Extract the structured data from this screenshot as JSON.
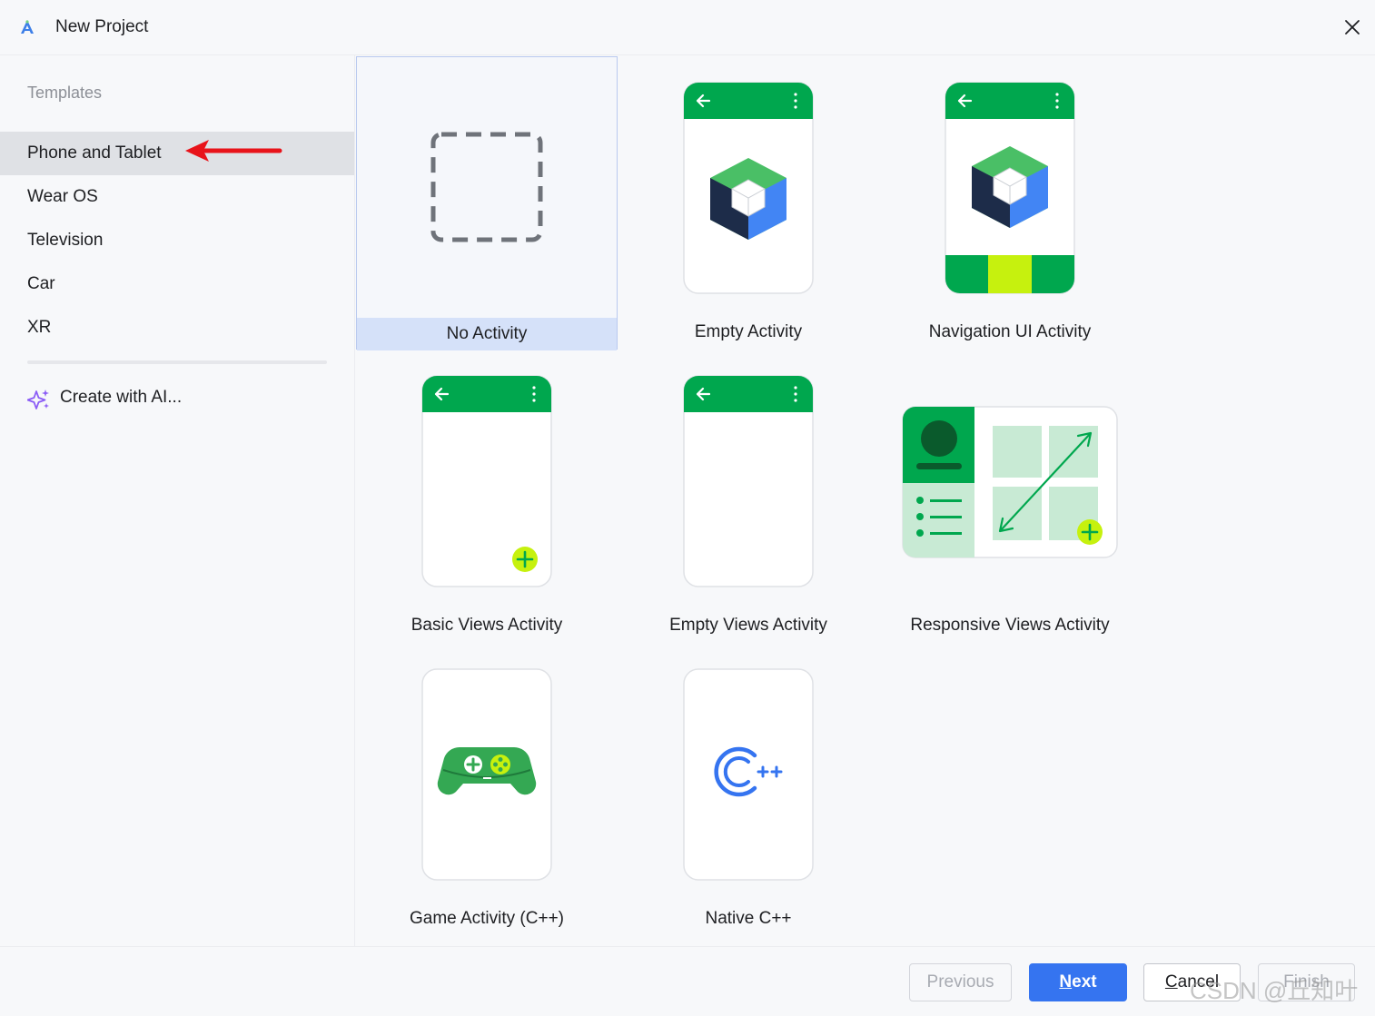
{
  "window": {
    "title": "New Project",
    "close_icon": "close-icon"
  },
  "sidebar": {
    "heading": "Templates",
    "items": [
      {
        "label": "Phone and Tablet",
        "selected": true
      },
      {
        "label": "Wear OS"
      },
      {
        "label": "Television"
      },
      {
        "label": "Car"
      },
      {
        "label": "XR"
      }
    ],
    "ai_item": {
      "label": "Create with AI...",
      "icon": "sparkle-icon"
    }
  },
  "templates": [
    {
      "label": "No Activity",
      "selected": true
    },
    {
      "label": "Empty Activity"
    },
    {
      "label": "Navigation UI Activity"
    },
    {
      "label": "Basic Views Activity"
    },
    {
      "label": "Empty Views Activity"
    },
    {
      "label": "Responsive Views Activity"
    },
    {
      "label": "Game Activity (C++)"
    },
    {
      "label": "Native C++"
    }
  ],
  "footer": {
    "previous": "Previous",
    "next_mnemonic": "N",
    "next_rest": "ext",
    "cancel_mnemonic": "C",
    "cancel_rest": "ancel",
    "finish": "Finish"
  },
  "watermark": "CSDN @丘知叶",
  "colors": {
    "accent": "#3574f0",
    "android_green": "#00a74e",
    "lime": "#c6f10e",
    "annotation_arrow": "#e8131a",
    "selection": "#d5e1f9"
  }
}
